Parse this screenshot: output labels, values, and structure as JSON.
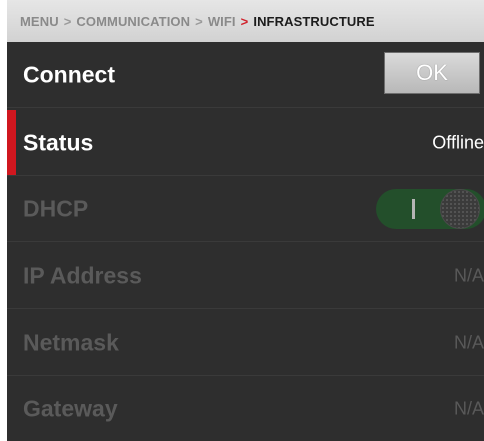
{
  "breadcrumb": {
    "items": [
      "MENU",
      "COMMUNICATION",
      "WIFI"
    ],
    "separator": ">",
    "current": "INFRASTRUCTURE"
  },
  "rows": {
    "connect": {
      "label": "Connect",
      "button_label": "OK"
    },
    "status": {
      "label": "Status",
      "value": "Offline"
    },
    "dhcp": {
      "label": "DHCP",
      "enabled": true
    },
    "ip_address": {
      "label": "IP Address",
      "value": "N/A"
    },
    "netmask": {
      "label": "Netmask",
      "value": "N/A"
    },
    "gateway": {
      "label": "Gateway",
      "value": "N/A"
    }
  },
  "colors": {
    "accent": "#d0171f",
    "background": "#2e2e2e",
    "toggle_on": "#234f2b",
    "disabled_text": "#5a5a5a"
  }
}
